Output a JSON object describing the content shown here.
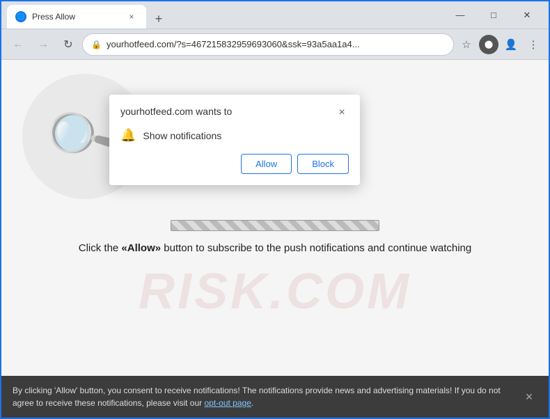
{
  "browser": {
    "tab": {
      "favicon": "●",
      "title": "Press Allow",
      "close": "×"
    },
    "new_tab_icon": "+",
    "window_controls": {
      "minimize": "—",
      "maximize": "□",
      "close": "✕"
    },
    "toolbar": {
      "back": "←",
      "forward": "→",
      "refresh": "↻",
      "url": "yourhotfeed.com/?s=467215832959693060&ssk=93a5aa1a4...",
      "lock_icon": "🔒",
      "star": "☆",
      "person": "👤",
      "more": "⋮",
      "ext_icon": "⬤"
    }
  },
  "popup": {
    "title": "yourhotfeed.com wants to",
    "close": "×",
    "bell": "🔔",
    "notification_label": "Show notifications",
    "allow_label": "Allow",
    "block_label": "Block"
  },
  "page": {
    "cta": "Click the «Allow» button to subscribe to the push notifications and continue watching"
  },
  "watermark": "RISK.COM",
  "notice": {
    "text": "By clicking 'Allow' button, you consent to receive notifications! The notifications provide news and advertising materials! If you do not agree to receive these notifications, please visit our ",
    "link_text": "opt-out page",
    "close": "×"
  }
}
